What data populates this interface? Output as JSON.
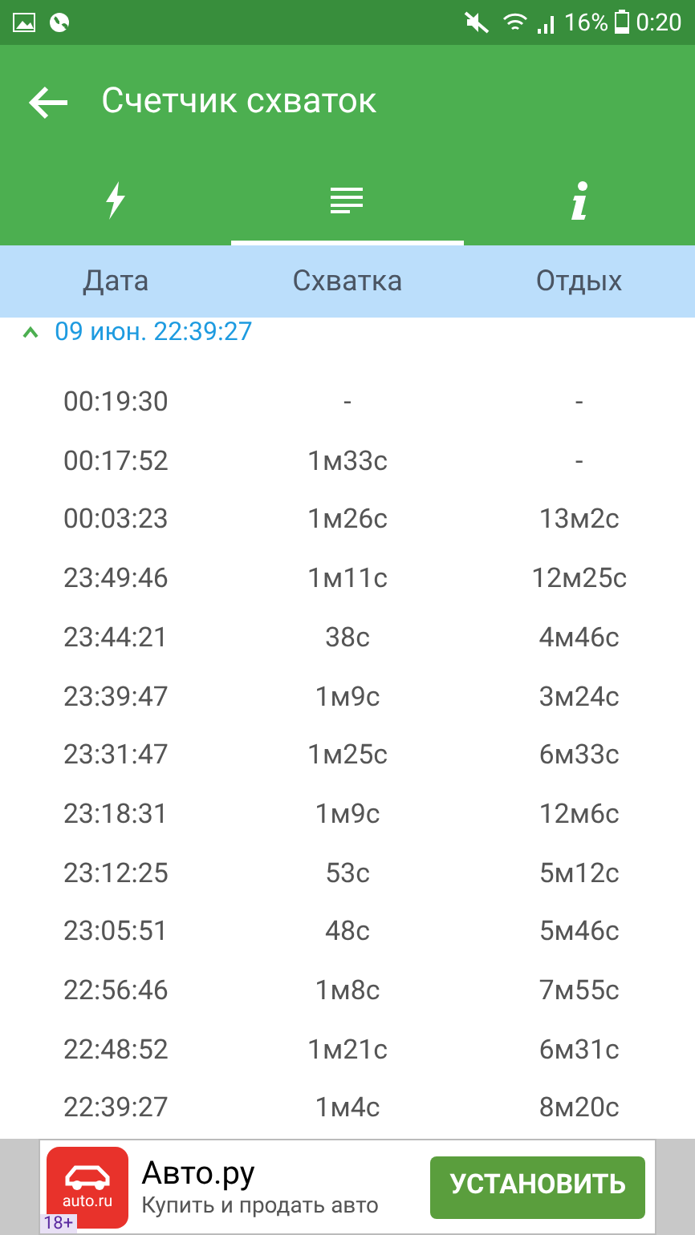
{
  "status_bar": {
    "battery": "16%",
    "time": "0:20"
  },
  "toolbar": {
    "title": "Счетчик схваток"
  },
  "tabs": [
    {
      "kind": "bolt",
      "selected": false
    },
    {
      "kind": "list",
      "selected": true
    },
    {
      "kind": "info",
      "selected": false
    }
  ],
  "table": {
    "columns": [
      "Дата",
      "Схватка",
      "Отдых"
    ],
    "group": {
      "title": "09 июн. 22:39:27",
      "expanded": true
    },
    "rows": [
      [
        "00:19:30",
        "-",
        "-"
      ],
      [
        "00:17:52",
        "1м33с",
        "-"
      ],
      [
        "00:03:23",
        "1м26с",
        "13м2с"
      ],
      [
        "23:49:46",
        "1м11с",
        "12м25с"
      ],
      [
        "23:44:21",
        "38с",
        "4м46с"
      ],
      [
        "23:39:47",
        "1м9с",
        "3м24с"
      ],
      [
        "23:31:47",
        "1м25с",
        "6м33с"
      ],
      [
        "23:18:31",
        "1м9с",
        "12м6с"
      ],
      [
        "23:12:25",
        "53с",
        "5м12с"
      ],
      [
        "23:05:51",
        "48с",
        "5м46с"
      ],
      [
        "22:56:46",
        "1м8с",
        "7м55с"
      ],
      [
        "22:48:52",
        "1м21с",
        "6м31с"
      ],
      [
        "22:39:27",
        "1м4с",
        "8м20с"
      ]
    ]
  },
  "ad": {
    "logo_text": "auto.ru",
    "age": "18+",
    "title": "Авто.ру",
    "subtitle": "Купить и продать авто",
    "button": "УСТАНОВИТЬ"
  }
}
